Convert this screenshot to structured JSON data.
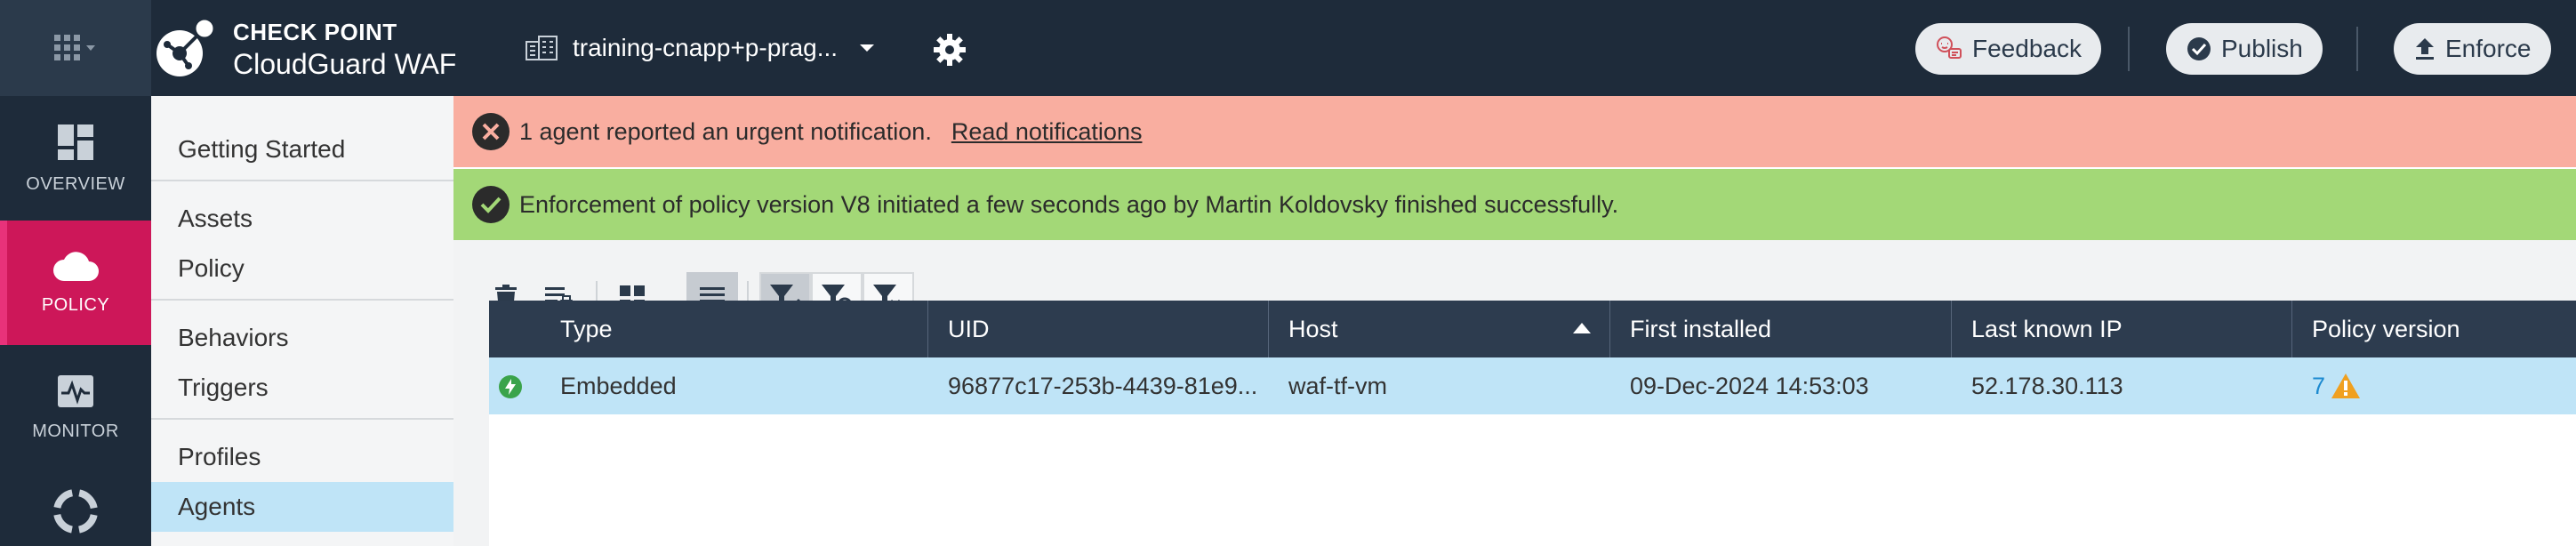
{
  "header": {
    "brand_line1": "CHECK POINT",
    "brand_line2": "CloudGuard WAF",
    "tenant": "training-cnapp+p-prag...",
    "feedback_label": "Feedback",
    "publish_label": "Publish",
    "enforce_label": "Enforce"
  },
  "rail": [
    {
      "label": "OVERVIEW",
      "icon": "dashboard-icon"
    },
    {
      "label": "POLICY",
      "icon": "cloud-icon",
      "active": true
    },
    {
      "label": "MONITOR",
      "icon": "pulse-icon"
    },
    {
      "label": "",
      "icon": "lifebuoy-icon"
    }
  ],
  "sidenav": {
    "items": [
      "Getting Started",
      "Assets",
      "Policy",
      "Behaviors",
      "Triggers",
      "Profiles",
      "Agents"
    ],
    "active": "Agents"
  },
  "alerts": {
    "error_text": "1 agent reported an urgent notification.",
    "error_link": "Read notifications",
    "success_text": "Enforcement of policy version V8 initiated a few seconds ago by Martin Koldovsky finished successfully."
  },
  "toolbar": {
    "icons": [
      "trash-icon",
      "bulk-edit-icon",
      "grid-view-icon",
      "list-view-icon",
      "filter-check-icon",
      "filter-block-icon",
      "filter-clear-icon"
    ]
  },
  "table": {
    "columns": [
      "Type",
      "UID",
      "Host",
      "First installed",
      "Last known IP",
      "Policy version"
    ],
    "sorted_column": "Host",
    "sort_direction": "ascending",
    "rows": [
      {
        "status": "active",
        "type": "Embedded",
        "uid": "96877c17-253b-4439-81e9...",
        "host": "waf-tf-vm",
        "first_installed": "09-Dec-2024 14:53:03",
        "last_ip": "52.178.30.113",
        "policy_version": "7",
        "warning": true
      }
    ]
  },
  "colors": {
    "topbar": "#1e2b3a",
    "active_rail": "#cd1759",
    "error_alert": "#f9aea0",
    "success_alert": "#a3d877",
    "selected_row": "#bfe4f7",
    "table_header": "#2d3c4f",
    "link": "#1c8ad0",
    "warning": "#f0a020"
  }
}
